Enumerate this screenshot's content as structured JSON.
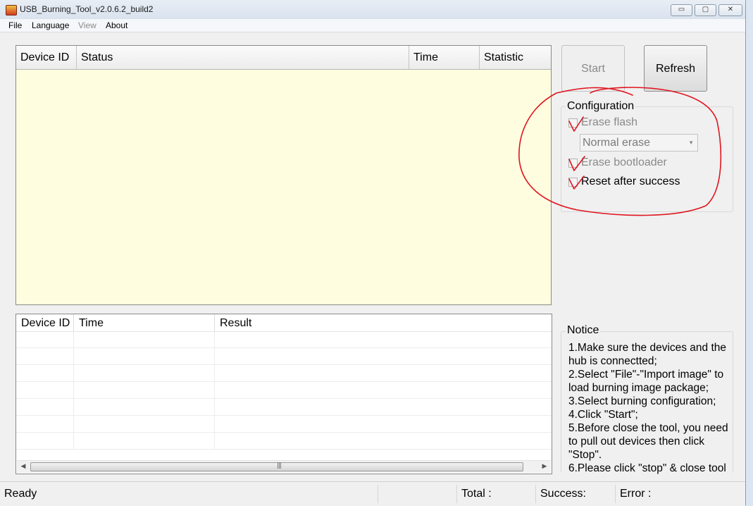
{
  "window": {
    "title": "USB_Burning_Tool_v2.0.6.2_build2",
    "controls": {
      "minimize": "▭",
      "maximize": "▢",
      "close": "✕"
    }
  },
  "menu": [
    {
      "label": "File",
      "enabled": true
    },
    {
      "label": "Language",
      "enabled": true
    },
    {
      "label": "View",
      "enabled": false
    },
    {
      "label": "About",
      "enabled": true
    }
  ],
  "device_table": {
    "columns": [
      "Device ID",
      "Status",
      "Time",
      "Statistic"
    ],
    "rows": []
  },
  "result_table": {
    "columns": [
      "Device ID",
      "Time",
      "Result"
    ],
    "rows": [],
    "scroll_grip": "|||"
  },
  "buttons": {
    "start": "Start",
    "refresh": "Refresh"
  },
  "configuration": {
    "title": "Configuration",
    "erase_flash": "Erase flash",
    "erase_mode": "Normal erase",
    "erase_bootloader": "Erase bootloader",
    "reset_after_success": "Reset after success"
  },
  "notice": {
    "title": "Notice",
    "lines": [
      "1.Make sure the devices and the hub is connectted;",
      "2.Select \"File\"-\"Import image\" to load burning image package;",
      "3.Select burning configuration;",
      "4.Click \"Start\";",
      "5.Before close the tool, you need to pull out devices then click \"Stop\".",
      "6.Please click \"stop\" & close tool"
    ]
  },
  "statusbar": {
    "status": "Ready",
    "total_label": "Total :",
    "success_label": "Success:",
    "error_label": "Error :"
  },
  "colors": {
    "annotation": "#e0141e",
    "device_panel_bg": "#fffde0"
  }
}
